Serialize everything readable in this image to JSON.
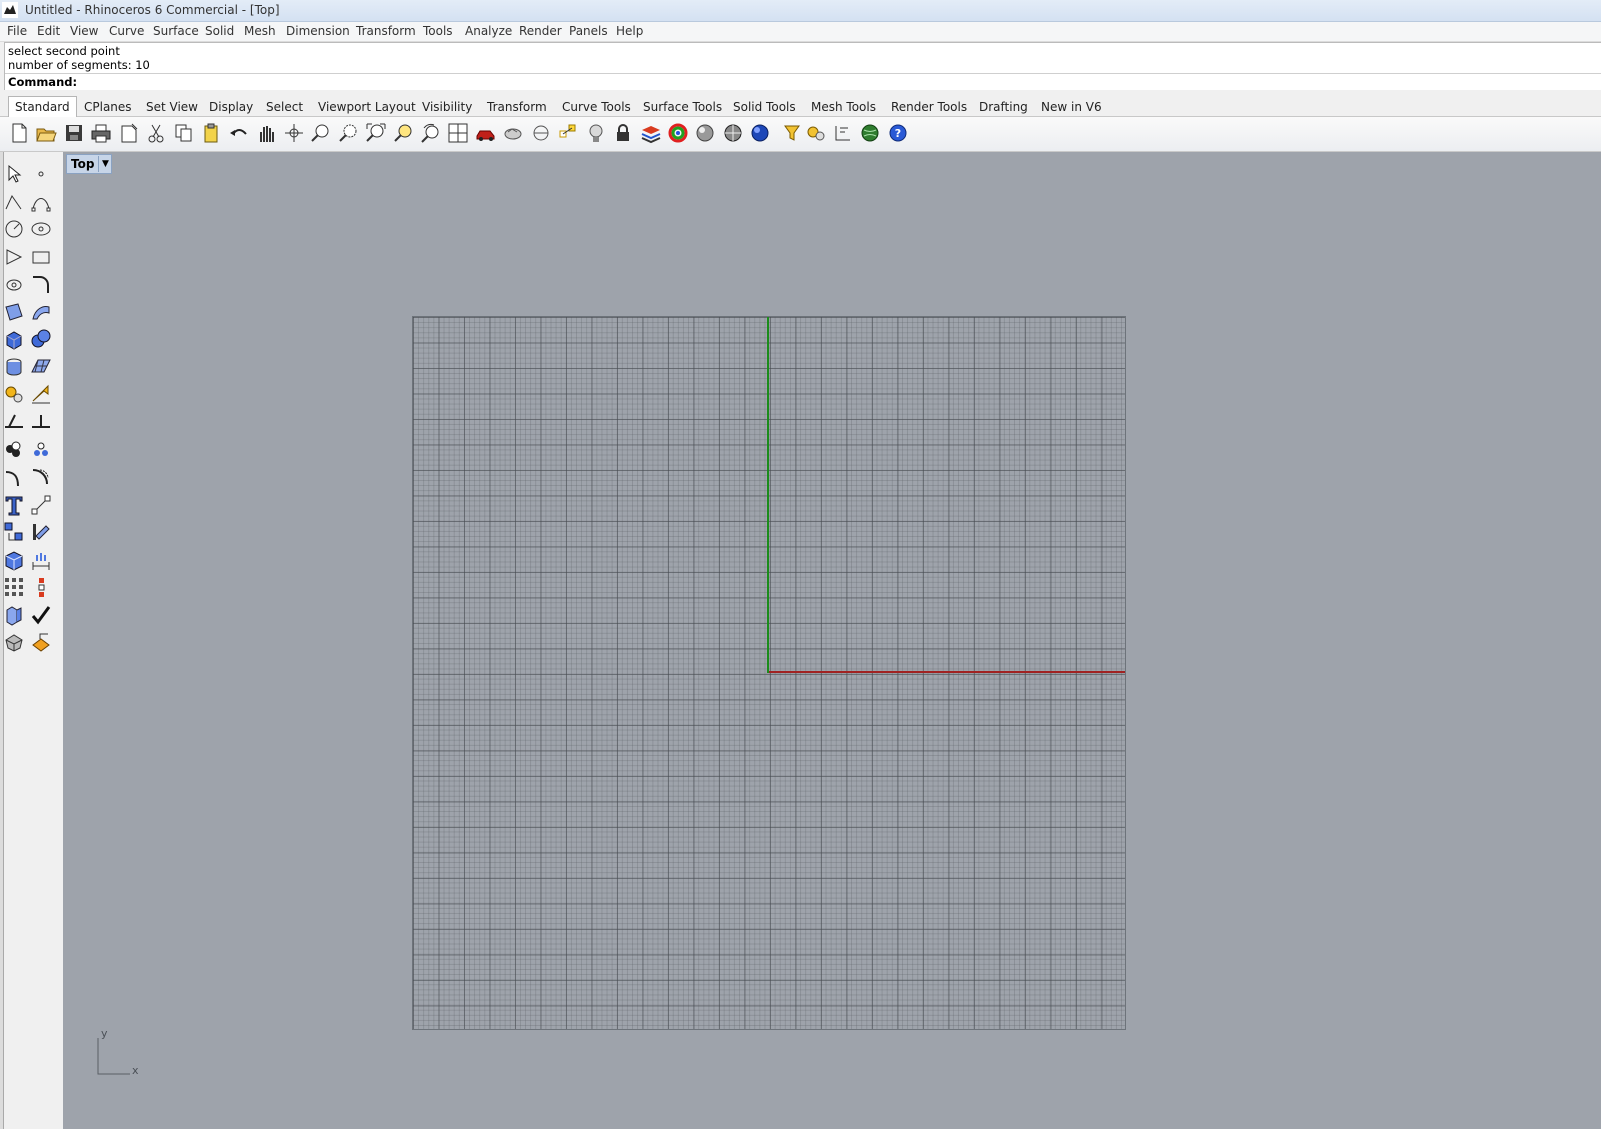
{
  "window": {
    "title": "Untitled - Rhinoceros 6 Commercial - [Top]"
  },
  "menu": [
    "File",
    "Edit",
    "View",
    "Curve",
    "Surface",
    "Solid",
    "Mesh",
    "Dimension",
    "Transform",
    "Tools",
    "Analyze",
    "Render",
    "Panels",
    "Help"
  ],
  "command_history": [
    "select second point",
    "number of segments: 10"
  ],
  "command": {
    "label": "Command:",
    "value": ""
  },
  "tabs": [
    "Standard",
    "CPlanes",
    "Set View",
    "Display",
    "Select",
    "Viewport Layout",
    "Visibility",
    "Transform",
    "Curve Tools",
    "Surface Tools",
    "Solid Tools",
    "Mesh Tools",
    "Render Tools",
    "Drafting",
    "New in V6"
  ],
  "active_tab": "Standard",
  "toolbar_icons": [
    "new-icon",
    "open-icon",
    "save-icon",
    "print-icon",
    "import-icon",
    "cut-icon",
    "copy-icon",
    "paste-icon",
    "undo-icon",
    "pan-icon",
    "rotate-view-icon",
    "zoom-icon",
    "zoom-window-icon",
    "zoom-extents-icon",
    "zoom-selected-icon",
    "undo-view-icon",
    "four-viewports-icon",
    "car-icon",
    "object-properties-icon",
    "cplane-icon",
    "osnap-icon",
    "light-icon",
    "lock-icon",
    "layers-icon",
    "color-icon",
    "shaded-icon",
    "rendered-icon",
    "render-icon",
    "filter-icon",
    "options-icon",
    "dimension-icon",
    "globe-icon",
    "help-icon"
  ],
  "sidebar_icons": [
    "select-icon",
    "point-icon",
    "polyline-icon",
    "curve-icon",
    "circle-icon",
    "ellipse-icon",
    "polygon-icon",
    "rectangle-icon",
    "arc-icon",
    "fillet-curve-icon",
    "surface-corner-icon",
    "extrude-curve-icon",
    "box-icon",
    "boolean-union-icon",
    "cylinder-icon",
    "surface-plane-icon",
    "explode-icon",
    "project-icon",
    "trim-icon",
    "split-icon",
    "group-icon",
    "ungroup-icon",
    "offset-icon",
    "blend-icon",
    "text-icon",
    "scale-icon",
    "array-icon",
    "align-icon",
    "block-icon",
    "dimension-side-icon",
    "grid-array-icon",
    "history-icon",
    "analyze-icon",
    "check-icon",
    "mesh-icon",
    "render-side-icon"
  ],
  "viewport": {
    "name": "Top",
    "axis_x": "x",
    "axis_y": "y"
  },
  "colors": {
    "viewport_bg": "#9ea3ab",
    "x_axis": "#a02222",
    "y_axis": "#1b8c1b"
  }
}
